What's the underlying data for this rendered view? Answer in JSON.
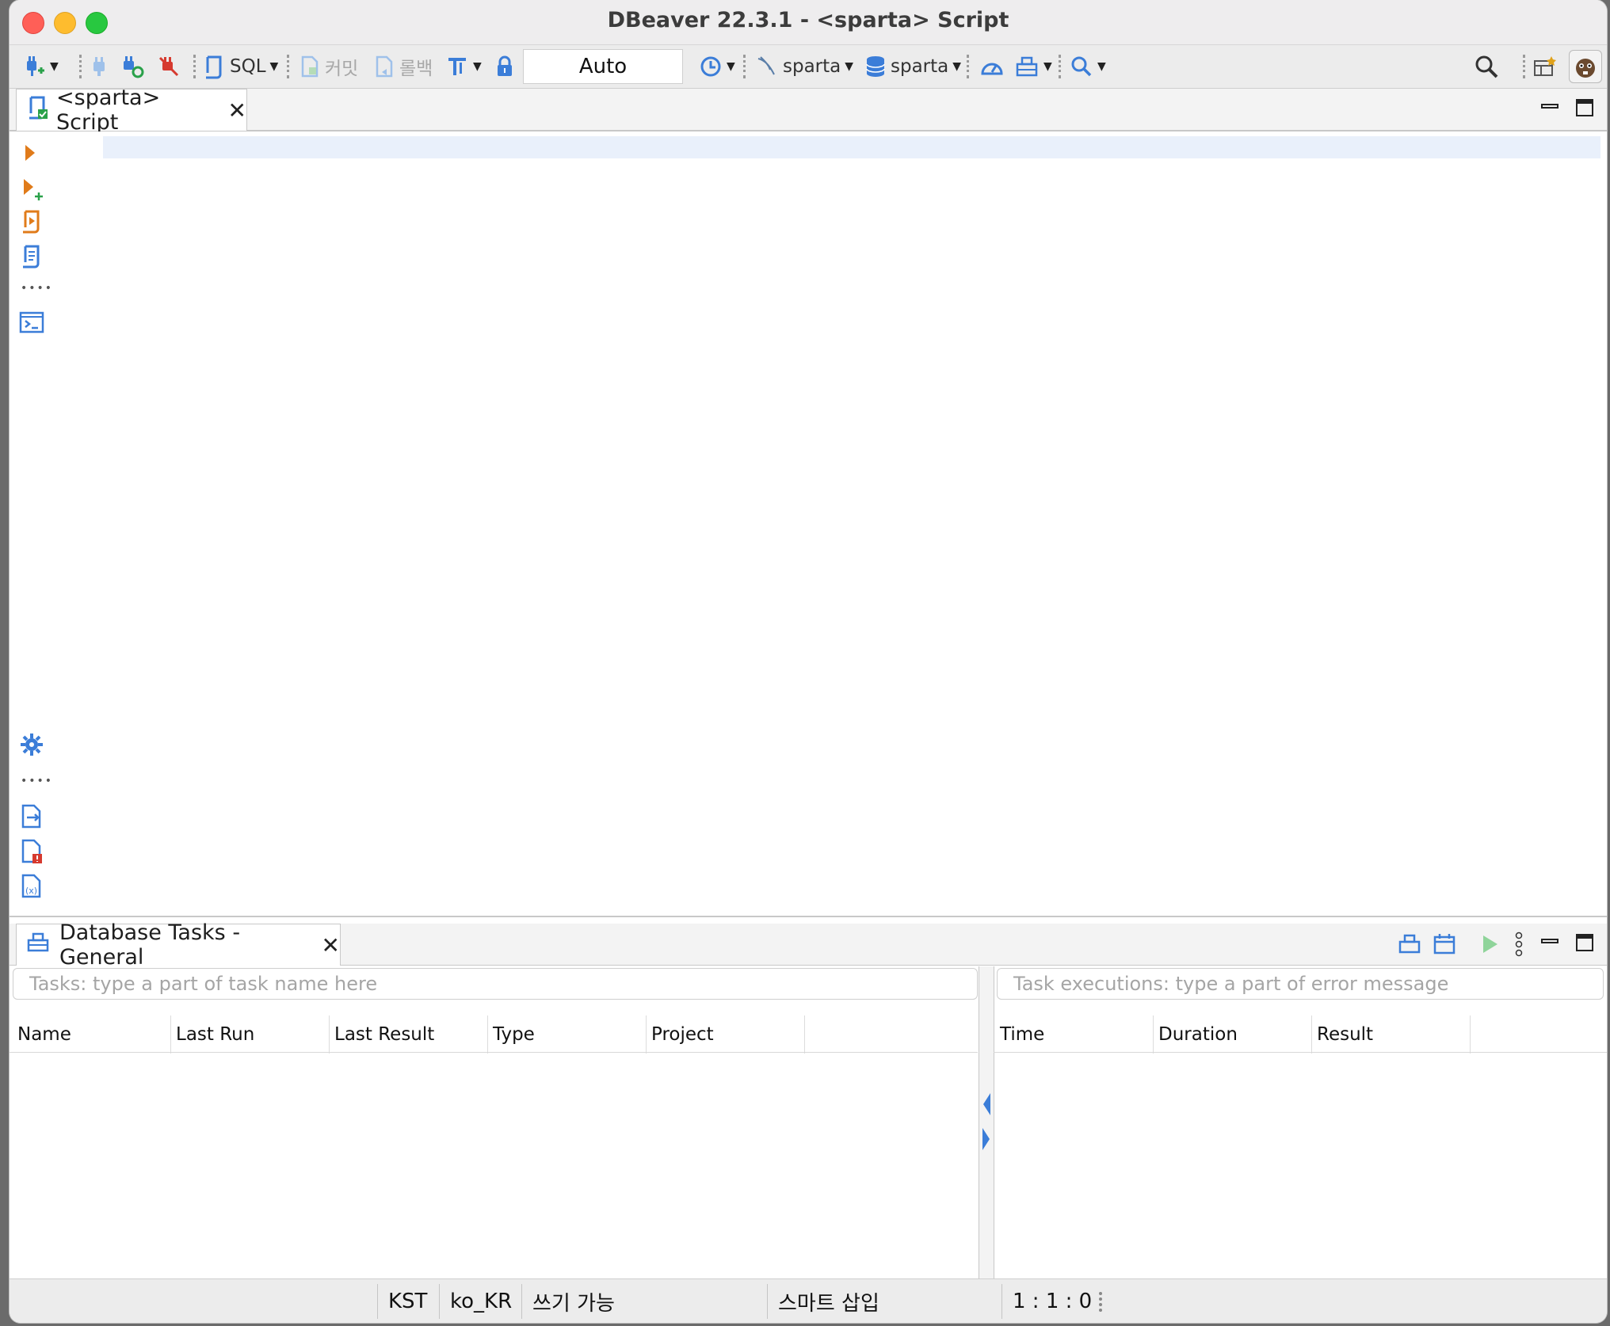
{
  "window": {
    "title": "DBeaver 22.3.1 - <sparta> Script"
  },
  "toolbar": {
    "sql_label": "SQL",
    "commit_label": "커밋",
    "rollback_label": "롤백",
    "transaction_mode": "Auto",
    "datasource_label": "sparta",
    "schema_label": "sparta"
  },
  "editor": {
    "tab_title": "<sparta> Script"
  },
  "tasks_panel": {
    "tab_title": "Database Tasks - General",
    "tasks_filter_placeholder": "Tasks: type a part of task name here",
    "executions_filter_placeholder": "Task executions: type a part of error message",
    "task_columns": [
      "Name",
      "Last Run",
      "Last Result",
      "Type",
      "Project"
    ],
    "execution_columns": [
      "Time",
      "Duration",
      "Result"
    ]
  },
  "status_bar": {
    "timezone": "KST",
    "locale": "ko_KR",
    "write_mode": "쓰기 가능",
    "insert_mode": "스마트 삽입",
    "cursor_position": "1 : 1 : 0"
  },
  "colors": {
    "accent_blue": "#3b7dd8",
    "run_orange": "#e07b1a",
    "disconnect_red": "#d63a2f",
    "current_line": "#e9f0fb"
  }
}
